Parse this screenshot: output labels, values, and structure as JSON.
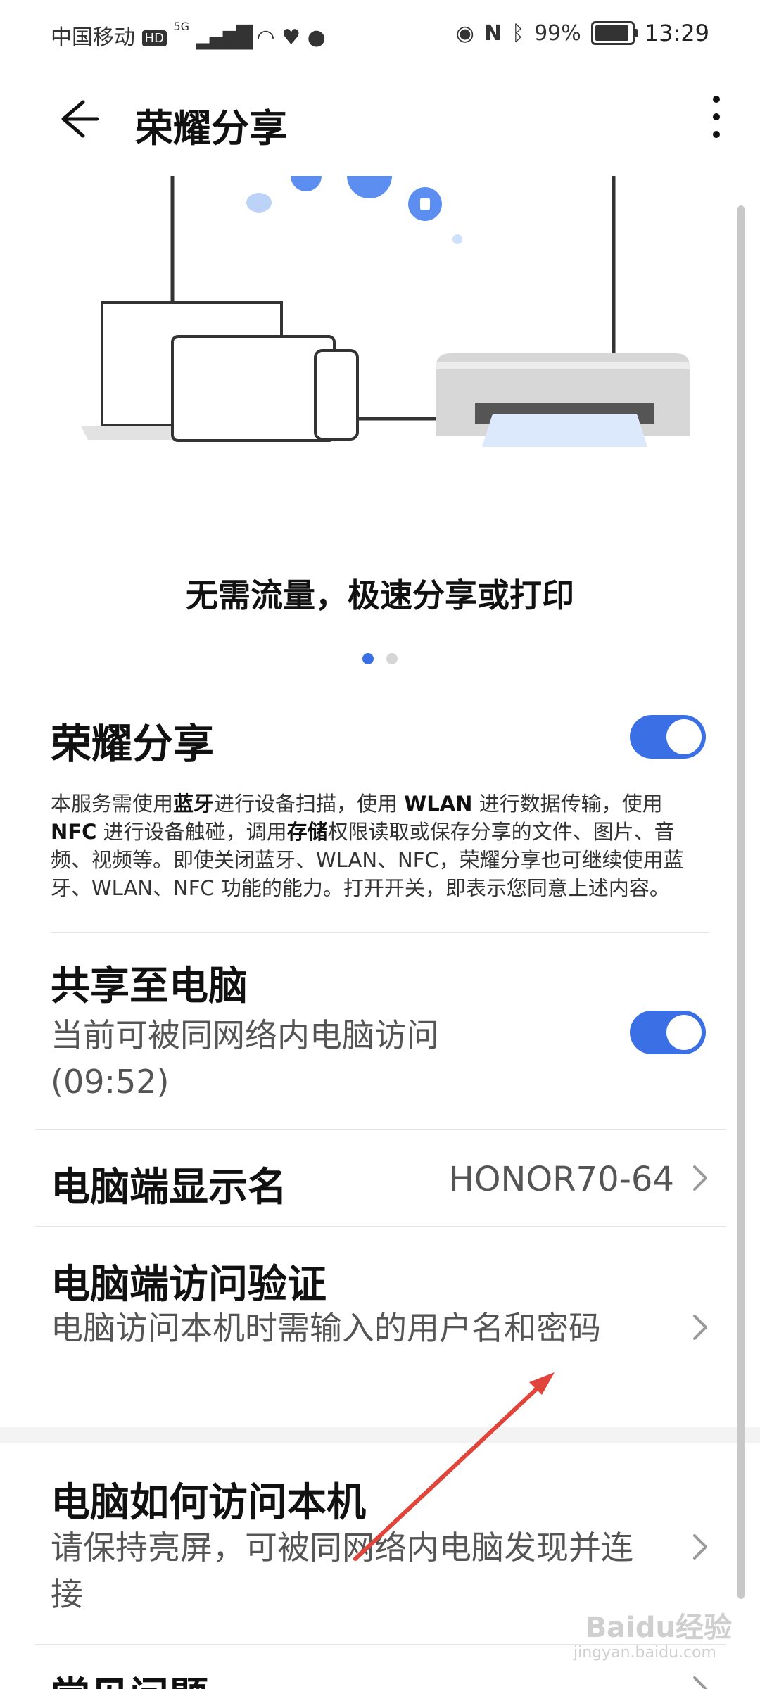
{
  "status_bar": {
    "carrier": "中国移动",
    "network_badges": [
      "HD",
      "5G"
    ],
    "battery_percent": "99%",
    "time": "13:29",
    "icons": [
      "signal-icon",
      "wifi-icon",
      "health-icon",
      "wechat-icon",
      "eye-icon",
      "nfc-icon",
      "bluetooth-icon",
      "battery-icon"
    ]
  },
  "app_bar": {
    "title": "荣耀分享",
    "back_icon": "arrow-left-icon",
    "more_icon": "more-vert-icon"
  },
  "banner": {
    "slogan": "无需流量，极速分享或打印",
    "pages": 2,
    "active_page": 1
  },
  "honor_share": {
    "title": "荣耀分享",
    "enabled": true,
    "description_parts": [
      {
        "text": "本服务需使用",
        "bold": false
      },
      {
        "text": "蓝牙",
        "bold": true
      },
      {
        "text": "进行设备扫描，使用 ",
        "bold": false
      },
      {
        "text": "WLAN",
        "bold": true
      },
      {
        "text": " 进行数据传输，使用 ",
        "bold": false
      },
      {
        "text": "NFC",
        "bold": true
      },
      {
        "text": " 进行设备触碰，调用",
        "bold": false
      },
      {
        "text": "存储",
        "bold": true
      },
      {
        "text": "权限读取或保存分享的文件、图片、音频、视频等。即使关闭蓝牙、WLAN、NFC，荣耀分享也可继续使用蓝牙、WLAN、NFC 功能的能力。打开开关，即表示您同意上述内容。",
        "bold": false
      }
    ]
  },
  "share_to_pc": {
    "title": "共享至电脑",
    "subtitle": "当前可被同网络内电脑访问(09:52)",
    "enabled": true
  },
  "pc_display_name": {
    "title": "电脑端显示名",
    "value": "HONOR70-64"
  },
  "pc_access_verify": {
    "title": "电脑端访问验证",
    "subtitle": "电脑访问本机时需输入的用户名和密码"
  },
  "pc_how_access": {
    "title": "电脑如何访问本机",
    "subtitle": "请保持亮屏，可被同网络内电脑发现并连接"
  },
  "faq": {
    "title": "常见问题"
  },
  "watermark": {
    "text": "Baidu经验",
    "sub": "jingyan.baidu.com"
  },
  "colors": {
    "accent": "#3b6fe6",
    "annotation_arrow": "#e0443a"
  }
}
